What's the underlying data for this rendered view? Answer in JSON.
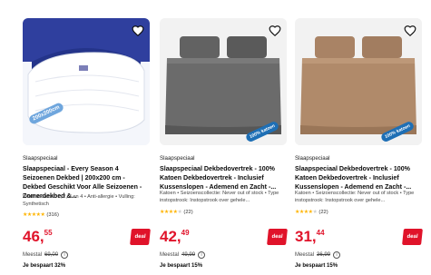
{
  "products": [
    {
      "seller": "Slaapspeciaal",
      "title": "Slaapspeciaal - Every Season 4 Seizoenen Dekbed | 200x200 cm - Dekbed Geschikt Voor Alle Seizoenen - Zomerdekbed &...",
      "description": "Warmteklasse: 1, 2, 3 en 4 • Anti-allergie • Vulling: Synthetisch",
      "rating": 5,
      "review_count": "(316)",
      "price_whole": "46,",
      "price_cents": "55",
      "deal_label": "deal",
      "was_label": "Meestal",
      "was_price": "69,00",
      "savings": "Je bespaart 32%",
      "image_badge": "200x200cm",
      "image_type": "duvet"
    },
    {
      "seller": "Slaapspeciaal",
      "title": "Slaapspeciaal Dekbedovertrek - 100% Katoen Dekbedovertrek - Inclusief Kussenslopen - Ademend en Zacht -...",
      "description": "Katoen • Seizoenscollectie: Never out of stock • Type instopstrook: Instopstrook over gehele...",
      "rating": 4,
      "review_count": "(22)",
      "price_whole": "42,",
      "price_cents": "49",
      "deal_label": "deal",
      "was_label": "Meestal",
      "was_price": "49,99",
      "savings": "Je bespaart 15%",
      "image_badge": "100% katoen",
      "image_type": "bed-grey"
    },
    {
      "seller": "Slaapspeciaal",
      "title": "Slaapspeciaal Dekbedovertrek - 100% Katoen Dekbedovertrek - Inclusief Kussenslopen - Ademend en Zacht -...",
      "description": "Katoen • Seizoenscollectie: Never out of stock • Type instopstrook: Instopstrook over gehele...",
      "rating": 4,
      "review_count": "(22)",
      "price_whole": "31,",
      "price_cents": "44",
      "deal_label": "deal",
      "was_label": "Meestal",
      "was_price": "36,99",
      "savings": "Je bespaart 15%",
      "image_badge": "100% katoen",
      "image_type": "bed-brown"
    }
  ],
  "icons": {
    "favorite": "heart-outline-icon",
    "info": "info-circle-icon",
    "star": "star-icon"
  },
  "colors": {
    "price": "#e0132a",
    "deal_bg": "#e0132a",
    "star": "#ffb400",
    "grey_bedding": "#6b6b6b",
    "brown_bedding": "#b08a6a"
  }
}
